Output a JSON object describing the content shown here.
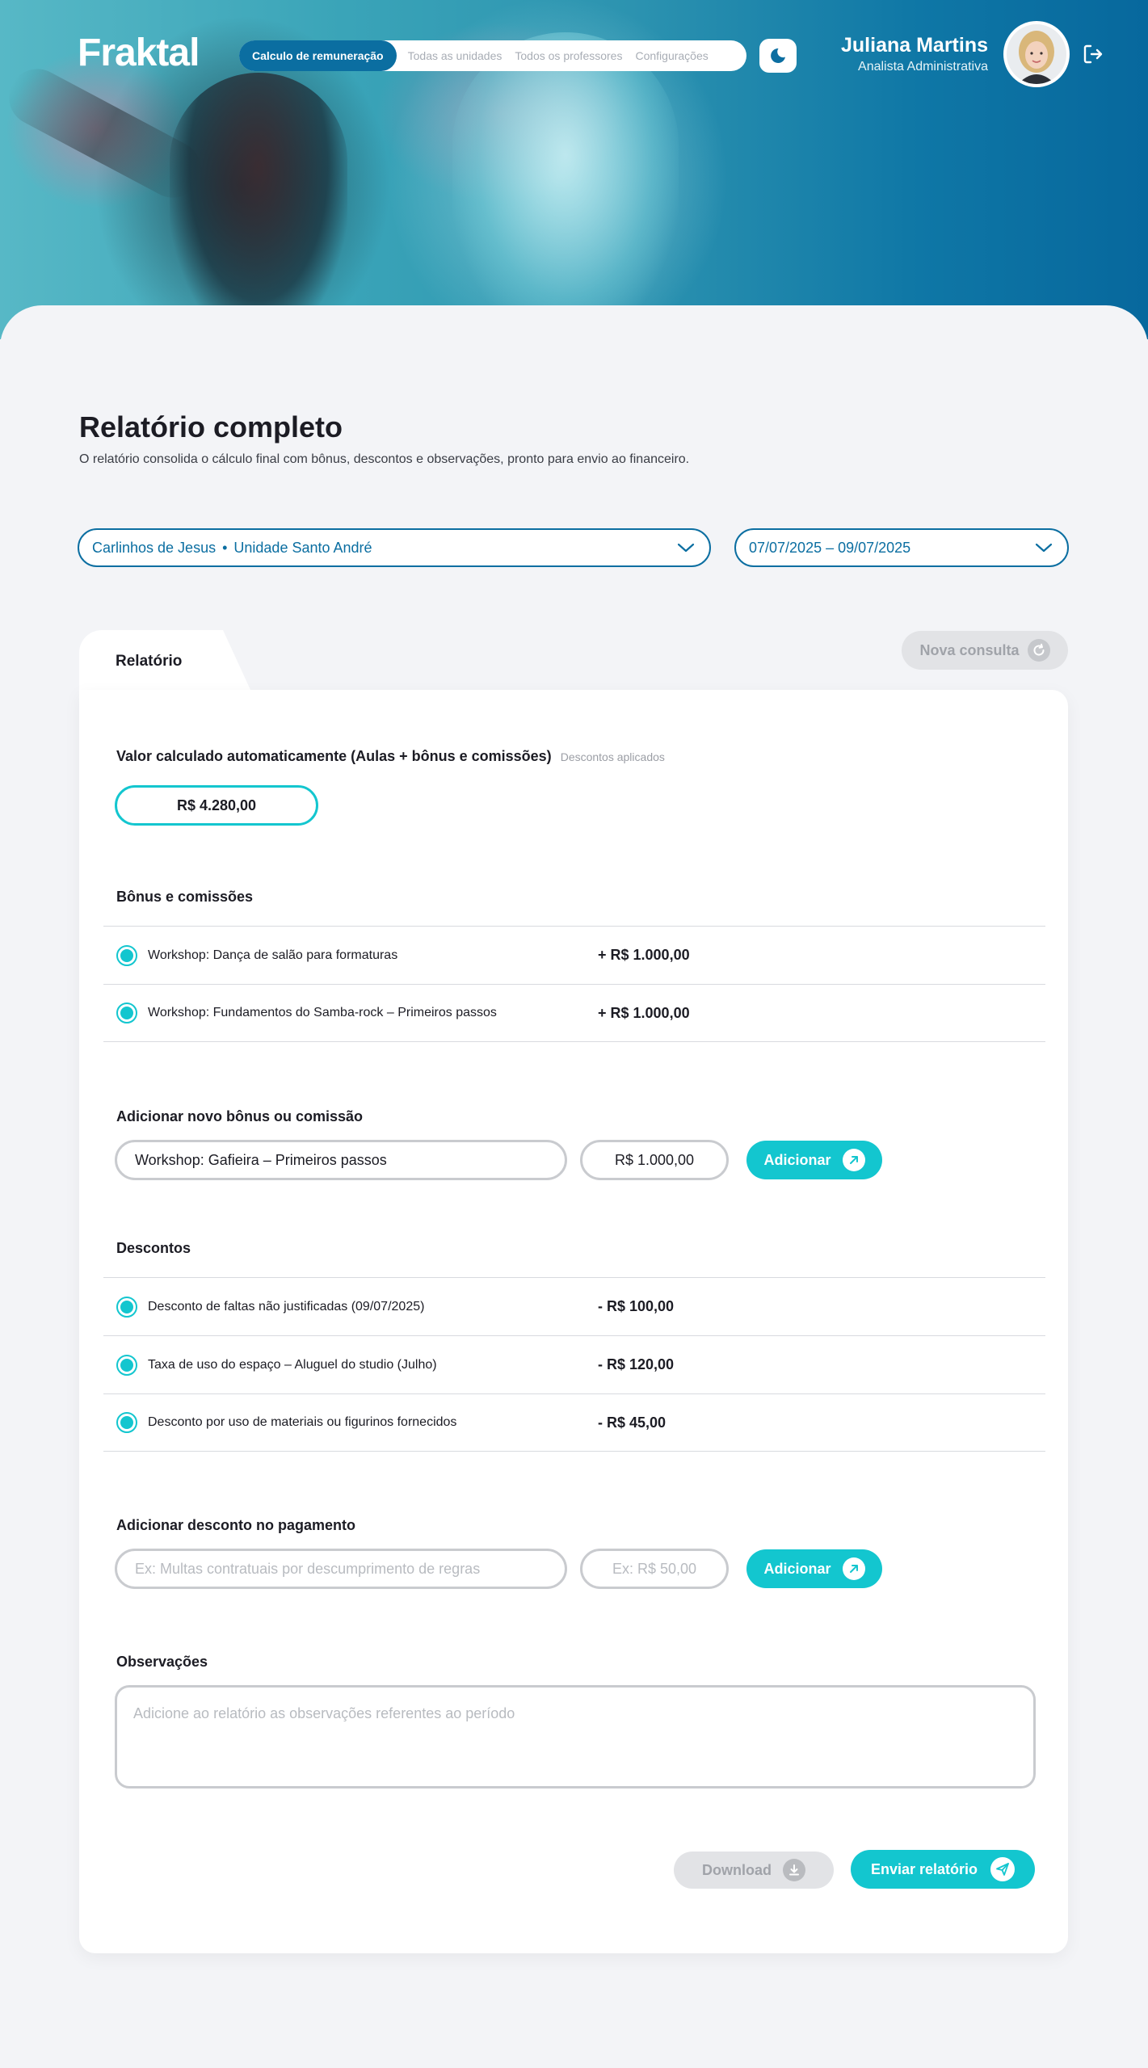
{
  "brand": {
    "logo": "Fraktal"
  },
  "nav": {
    "items": [
      {
        "label": "Calculo de remuneração",
        "active": true
      },
      {
        "label": "Todas as unidades",
        "active": false
      },
      {
        "label": "Todos os professores",
        "active": false
      },
      {
        "label": "Configurações",
        "active": false
      }
    ]
  },
  "user": {
    "name": "Juliana Martins",
    "role": "Analista Administrativa"
  },
  "page": {
    "title": "Relatório completo",
    "subtitle": "O relatório consolida o cálculo final com bônus, descontos e observações, pronto para envio ao financeiro."
  },
  "filters": {
    "teacher": "Carlinhos de Jesus",
    "unit": "Unidade Santo André",
    "separator": "•",
    "period": "07/07/2025 – 09/07/2025"
  },
  "tab": {
    "label": "Relatório"
  },
  "actions": {
    "new_query": "Nova consulta",
    "download": "Download",
    "send": "Enviar relatório"
  },
  "calculated": {
    "title": "Valor calculado automaticamente (Aulas + bônus e comissões)",
    "note": "Descontos aplicados",
    "value": "R$ 4.280,00"
  },
  "bonus": {
    "title": "Bônus e comissões",
    "items": [
      {
        "label": "Workshop: Dança de salão para formaturas",
        "amount": "+ R$ 1.000,00",
        "checked": true
      },
      {
        "label": "Workshop: Fundamentos do Samba-rock – Primeiros passos",
        "amount": "+ R$ 1.000,00",
        "checked": true
      }
    ]
  },
  "add_bonus": {
    "title": "Adicionar novo bônus ou comissão",
    "description_value": "Workshop: Gafieira – Primeiros passos",
    "amount_value": "R$ 1.000,00",
    "button": "Adicionar"
  },
  "discounts": {
    "title": "Descontos",
    "items": [
      {
        "label": "Desconto de faltas não justificadas (09/07/2025)",
        "amount": "- R$ 100,00",
        "checked": true
      },
      {
        "label": "Taxa de uso do espaço – Aluguel do studio (Julho)",
        "amount": "- R$ 120,00",
        "checked": true
      },
      {
        "label": "Desconto por uso de materiais ou figurinos fornecidos",
        "amount": "- R$ 45,00",
        "checked": true
      }
    ]
  },
  "add_discount": {
    "title": "Adicionar desconto no pagamento",
    "description_placeholder": "Ex: Multas contratuais por descumprimento de regras",
    "amount_placeholder": "Ex: R$ 50,00",
    "button": "Adicionar"
  },
  "notes": {
    "title": "Observações",
    "placeholder": "Adicione ao relatório as observações referentes ao período"
  },
  "colors": {
    "primary": "#0b6ea1",
    "accent": "#13c6cf",
    "muted": "#e2e3e6"
  },
  "icons": {
    "theme": "moon-star-icon",
    "logout": "logout-icon",
    "dropdown": "chevron-down-icon",
    "refresh": "refresh-icon",
    "add": "arrow-up-right-icon",
    "download": "download-icon",
    "send": "paper-plane-icon",
    "check": "radio-checked-icon"
  }
}
